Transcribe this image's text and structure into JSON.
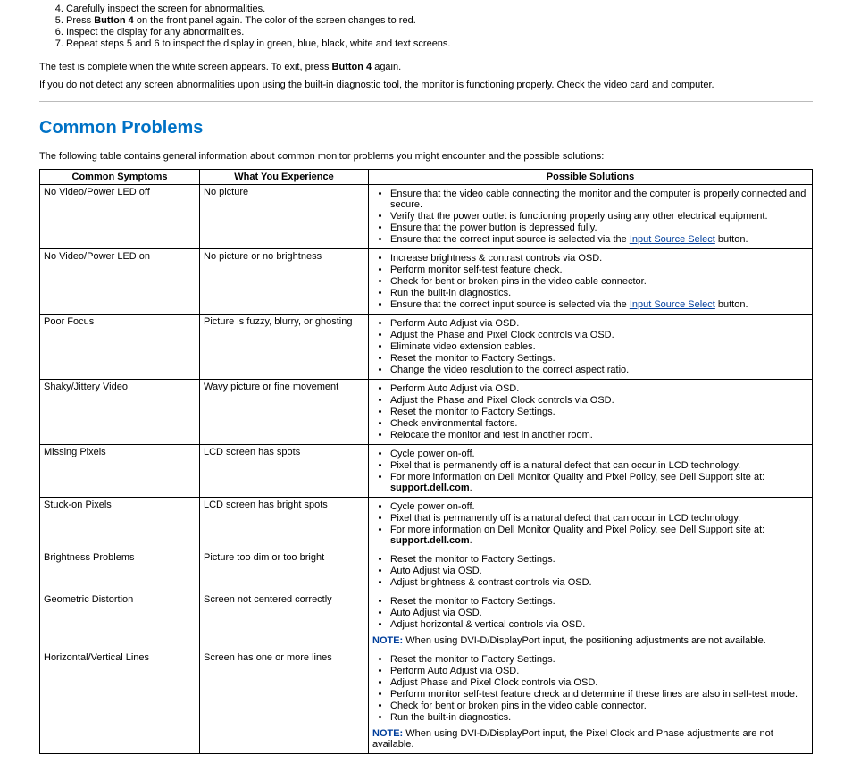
{
  "steps": {
    "s4": "Carefully inspect the screen for abnormalities.",
    "s5a": "Press ",
    "s5b": "Button 4",
    "s5c": " on the front panel again. The color of the screen changes to red.",
    "s6": "Inspect the display for any abnormalities.",
    "s7": "Repeat steps 5 and 6 to inspect the display in green, blue, black, white and text screens."
  },
  "p_complete_a": "The test is complete when the white screen appears. To exit, press ",
  "p_complete_b": "Button 4",
  "p_complete_c": " again.",
  "p_detect": "If you do not detect any screen abnormalities upon using the built-in diagnostic tool, the monitor is functioning properly. Check the video card and computer.",
  "h2": "Common Problems",
  "intro": "The following table contains general information about common monitor problems you might encounter and the possible solutions:",
  "th": {
    "sym": "Common Symptoms",
    "exp": "What You Experience",
    "sol": "Possible Solutions"
  },
  "link_input_source": "Input Source Select",
  "support_site": "support.dell.com",
  "rows": {
    "r1": {
      "sym": "No Video/Power LED off",
      "exp": "No picture",
      "s1": "Ensure that the video cable connecting the monitor and the computer is properly connected and secure.",
      "s2": "Verify that the power outlet is functioning properly using any other electrical equipment.",
      "s3": "Ensure that the power button is depressed fully.",
      "s4a": "Ensure that the correct input source is selected via the ",
      "s4b": " button."
    },
    "r2": {
      "sym": "No Video/Power LED on",
      "exp": "No picture or no brightness",
      "s1": "Increase brightness & contrast controls via OSD.",
      "s2": "Perform monitor self-test feature check.",
      "s3": "Check for bent or broken pins in the video cable connector.",
      "s4": "Run the built-in diagnostics.",
      "s5a": "Ensure that the correct input source is selected via the ",
      "s5b": " button."
    },
    "r3": {
      "sym": "Poor Focus",
      "exp": "Picture is fuzzy, blurry, or ghosting",
      "s1": "Perform Auto Adjust via OSD.",
      "s2": "Adjust the Phase and Pixel Clock controls via OSD.",
      "s3": "Eliminate video extension cables.",
      "s4": "Reset the monitor to Factory Settings.",
      "s5": "Change the video resolution to the correct aspect ratio."
    },
    "r4": {
      "sym": "Shaky/Jittery Video",
      "exp": "Wavy picture or fine movement",
      "s1": "Perform Auto Adjust via OSD.",
      "s2": "Adjust the Phase and Pixel Clock controls via OSD.",
      "s3": "Reset the monitor to Factory Settings.",
      "s4": "Check environmental factors.",
      "s5": "Relocate the monitor and test in another room."
    },
    "r5": {
      "sym": "Missing Pixels",
      "exp": "LCD screen has spots",
      "s1": "Cycle power on-off.",
      "s2": "Pixel that is permanently off is a natural defect that can occur in LCD technology.",
      "s3a": "For more information on Dell Monitor Quality and Pixel Policy, see Dell Support site at: ",
      "s3b": "."
    },
    "r6": {
      "sym": "Stuck-on Pixels",
      "exp": "LCD screen has bright spots",
      "s1": "Cycle power on-off.",
      "s2": "Pixel that is permanently off is a natural defect that can occur in LCD technology.",
      "s3a": "For more information on Dell Monitor Quality and Pixel Policy, see Dell Support site at: ",
      "s3b": "."
    },
    "r7": {
      "sym": "Brightness Problems",
      "exp": "Picture too dim or too bright",
      "s1": "Reset the monitor to Factory Settings.",
      "s2": "Auto Adjust via OSD.",
      "s3": "Adjust brightness & contrast controls via OSD."
    },
    "r8": {
      "sym": "Geometric Distortion",
      "exp": "Screen not centered correctly",
      "s1": "Reset the monitor to Factory Settings.",
      "s2": "Auto Adjust via OSD.",
      "s3": "Adjust horizontal & vertical controls via OSD.",
      "note_label": "NOTE:",
      "note_text": " When using DVI-D/DisplayPort input, the positioning adjustments are not available."
    },
    "r9": {
      "sym": "Horizontal/Vertical Lines",
      "exp": "Screen has one or more lines",
      "s1": "Reset the monitor to Factory Settings.",
      "s2": "Perform Auto Adjust via OSD.",
      "s3": "Adjust Phase and Pixel Clock controls via OSD.",
      "s4": "Perform monitor self-test feature check and determine if these lines are also in self-test mode.",
      "s5": "Check for bent or broken pins in the video cable connector.",
      "s6": "Run the built-in diagnostics.",
      "note_label": "NOTE:",
      "note_text": " When using DVI-D/DisplayPort input, the Pixel Clock and Phase adjustments are not available."
    }
  }
}
